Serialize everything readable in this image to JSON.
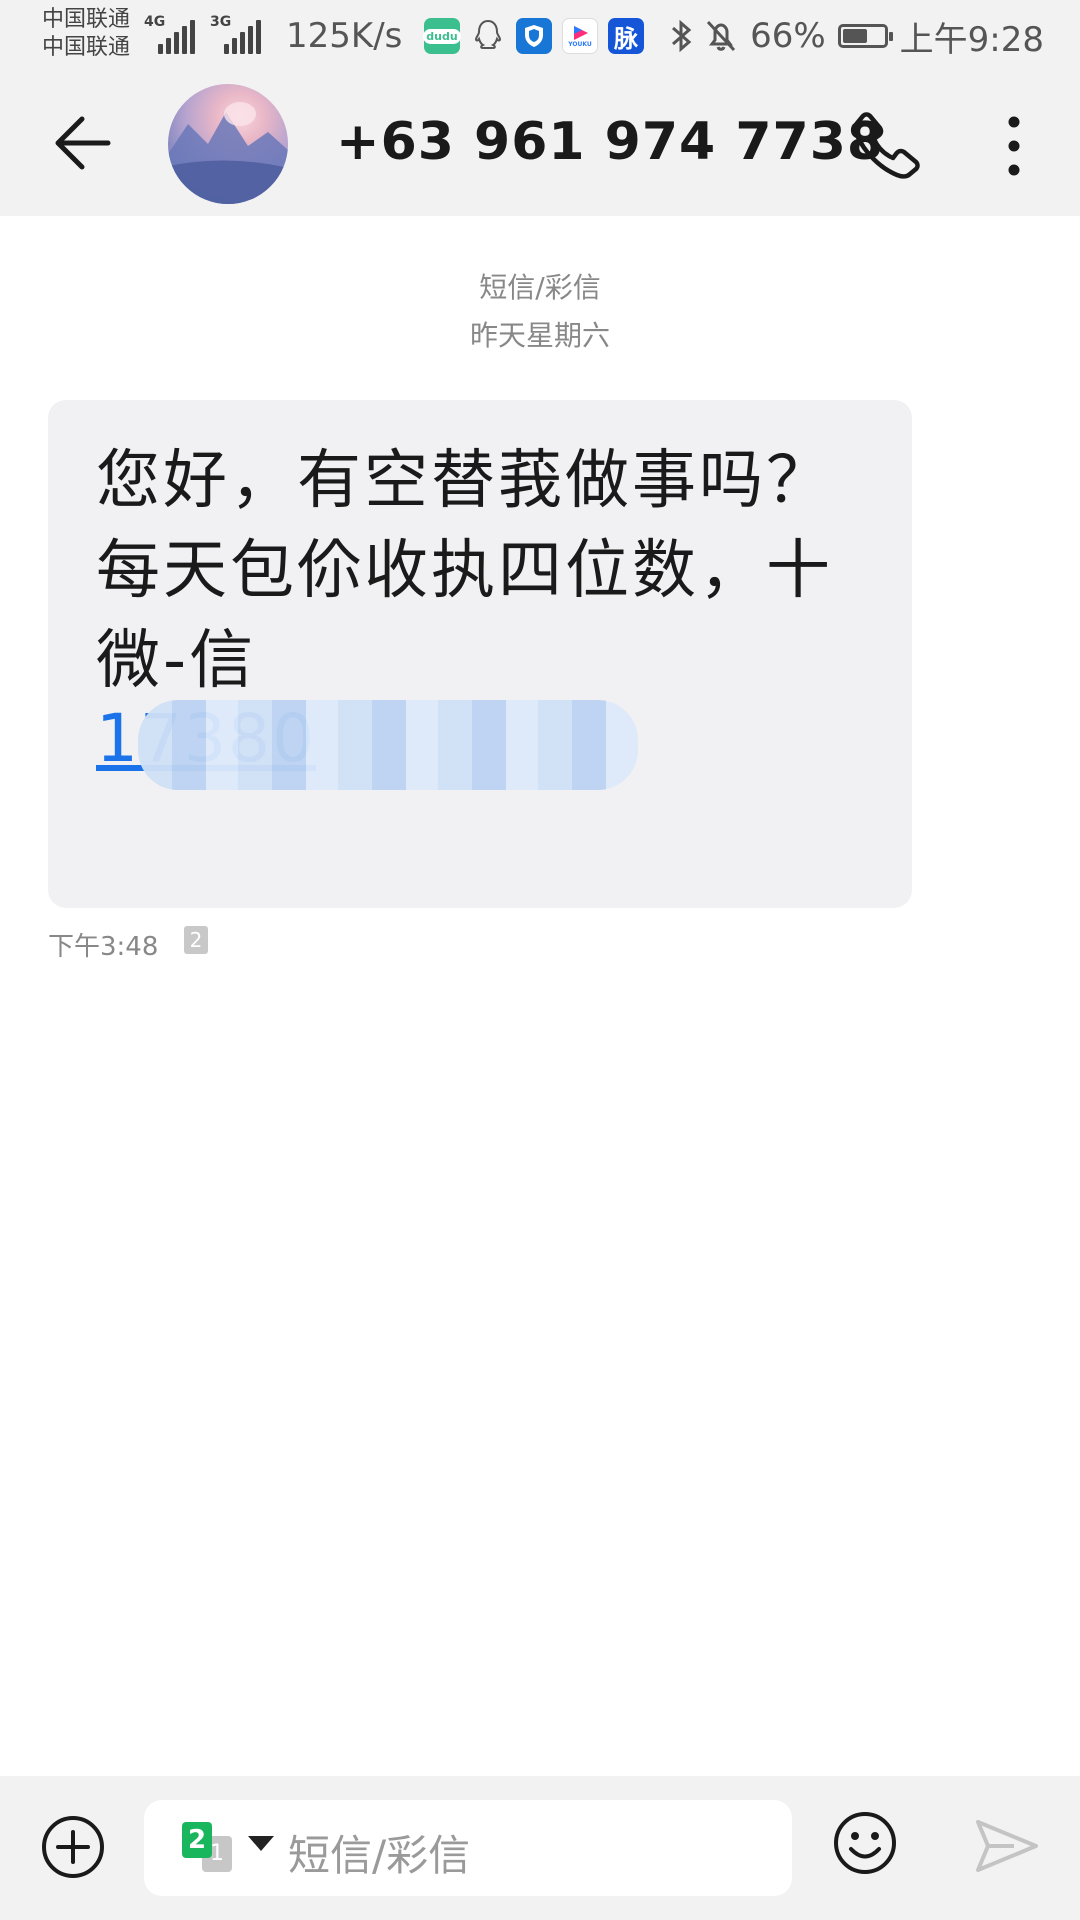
{
  "status_bar": {
    "carrier_1": "中国联通",
    "carrier_2": "中国联通",
    "network_1": "4G",
    "network_2": "3G",
    "net_speed": "125K/s",
    "app_icons": [
      "dudu-icon",
      "qq-icon",
      "shield-icon",
      "youku-icon",
      "mai-icon"
    ],
    "app_icon_labels": {
      "dudu": "dudu",
      "youku": "YOUKU",
      "mai": "脉"
    },
    "battery_percent": "66%",
    "battery_level": 0.66,
    "time": "上午9:28"
  },
  "header": {
    "contact": "+63 961 974 7738"
  },
  "thread": {
    "type_label": "短信/彩信",
    "date_label": "昨天星期六",
    "messages": [
      {
        "text": "您好，有空替莪做事吗？每天包伱收执四位数，十 微-信",
        "link_text": "17380",
        "time": "下午3:48",
        "sim": "2"
      }
    ]
  },
  "composer": {
    "placeholder": "短信/彩信",
    "sim_active": "2",
    "sim_other": "1"
  },
  "colors": {
    "bar_bg": "#f2f2f2",
    "bubble_bg": "#f1f1f3",
    "link": "#1a73e8",
    "sim_green": "#19b65e"
  }
}
